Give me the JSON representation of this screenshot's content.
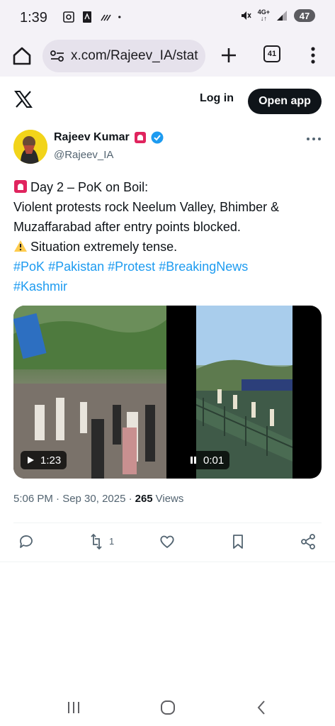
{
  "status_bar": {
    "time": "1:39",
    "network": "4G+",
    "battery": "47",
    "icons": [
      "screenshot-icon",
      "pdf-icon",
      "signal-weak-icon",
      "dot-icon",
      "mute-icon",
      "wifi-icon",
      "cell-signal-icon"
    ]
  },
  "browser": {
    "url": "x.com/Rajeev_IA/stat",
    "tab_count": "41"
  },
  "x_header": {
    "login_label": "Log in",
    "open_app_label": "Open app"
  },
  "tweet": {
    "author_name": "Rajeev Kumar",
    "author_handle": "@Rajeev_IA",
    "line1": "Day 2 – PoK on Boil:",
    "line2": "Violent protests rock Neelum Valley, Bhimber &",
    "line3": "Muzaffarabad after entry points blocked.",
    "line4": "Situation extremely tense.",
    "hashtags_line1": [
      "#PoK",
      "#Pakistan",
      "#Protest",
      "#BreakingNews"
    ],
    "hashtags_line2": [
      "#Kashmir"
    ],
    "media": [
      {
        "duration": "1:23",
        "state": "play"
      },
      {
        "duration": "0:01",
        "state": "pause"
      }
    ],
    "timestamp": "5:06 PM · Sep 30, 2025 ·",
    "views_count": "265",
    "views_label": "Views",
    "retweet_count": "1"
  },
  "colors": {
    "link": "#1d9bf0",
    "text": "#0f1419",
    "secondary": "#536471",
    "verified": "#1d9bf0"
  }
}
